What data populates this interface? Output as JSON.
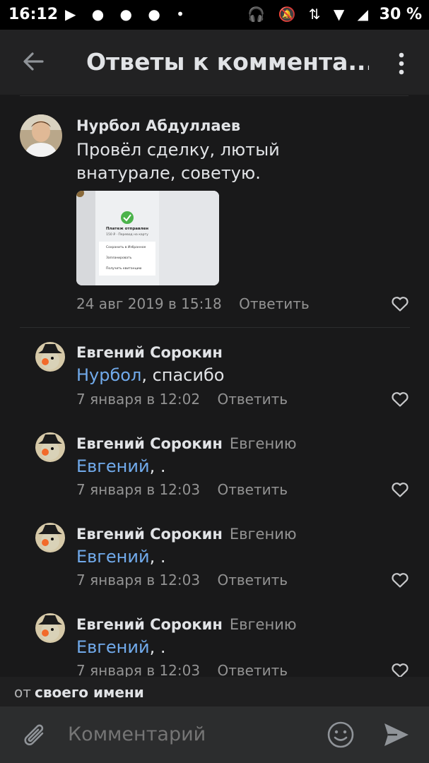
{
  "status_bar": {
    "time": "16:12",
    "left_icons": "▶ ● ● ● •",
    "right_icons": "🎧 🔕 ⇅ ▼ ◢",
    "battery": "30 %"
  },
  "app_bar": {
    "title": "Ответы к коммента..."
  },
  "root_comment": {
    "author": "Нурбол Абдуллаев",
    "text": "Провёл сделку, лютый внатурале, советую.",
    "date": "24 авг 2019 в 15:18",
    "reply_label": "Ответить",
    "attachment": {
      "title": "Платеж отправлен",
      "subtitle": "150 ₽ · Перевод на карту",
      "items": [
        "Сохранить в Избранное",
        "Запланировать",
        "Получить квитанцию"
      ]
    }
  },
  "replies": [
    {
      "author": "Евгений Сорокин",
      "reply_to": "",
      "mention": "Нурбол",
      "text": ", спасибо",
      "date": "7 января в 12:02",
      "reply_label": "Ответить"
    },
    {
      "author": "Евгений Сорокин",
      "reply_to": "Евгению",
      "mention": "Евгений",
      "text": ", .",
      "date": "7 января в 12:03",
      "reply_label": "Ответить"
    },
    {
      "author": "Евгений Сорокин",
      "reply_to": "Евгению",
      "mention": "Евгений",
      "text": ", .",
      "date": "7 января в 12:03",
      "reply_label": "Ответить"
    },
    {
      "author": "Евгений Сорокин",
      "reply_to": "Евгению",
      "mention": "Евгений",
      "text": ", .",
      "date": "7 января в 12:03",
      "reply_label": "Ответить"
    }
  ],
  "composer": {
    "hint_prefix": "от",
    "hint_bold": "своего имени",
    "placeholder": "Комментарий"
  },
  "icons": {
    "back": "arrow-left-icon",
    "more": "more-vertical-icon",
    "like": "heart-outline-icon",
    "attach": "paperclip-icon",
    "emoji": "smile-icon",
    "send": "send-icon"
  },
  "colors": {
    "background": "#19191a",
    "accent": "#71aaeb",
    "secondary_text": "#939393"
  }
}
